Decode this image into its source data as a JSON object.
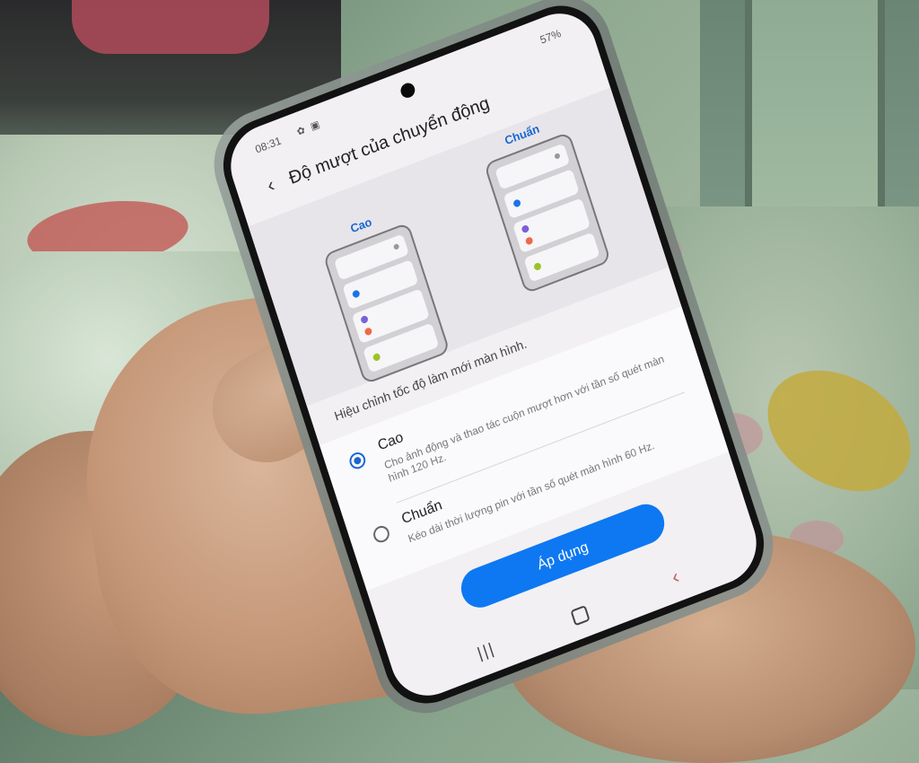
{
  "status_bar": {
    "time": "08:31",
    "icons": "✿ ▣",
    "battery": "57%"
  },
  "header": {
    "back_icon": "‹",
    "title": "Độ mượt của chuyển động"
  },
  "preview": {
    "high_label": "Cao",
    "standard_label": "Chuẩn"
  },
  "description": "Hiệu chỉnh tốc độ làm mới màn hình.",
  "options": [
    {
      "title": "Cao",
      "desc": "Cho ảnh động và thao tác cuộn mượt hơn với tần số quét màn hình 120 Hz.",
      "selected": true
    },
    {
      "title": "Chuẩn",
      "desc": "Kéo dài thời lượng pin với tần số quét màn hình 60 Hz.",
      "selected": false
    }
  ],
  "apply_label": "Áp dụng",
  "nav": {
    "recent_icon": "|||",
    "back_icon": "‹"
  },
  "colors": {
    "accent": "#1967d2",
    "button": "#0d78f2",
    "dot_blue": "#1a73e8",
    "dot_purple": "#7b61d9",
    "dot_orange": "#f06848",
    "dot_green": "#9bc424"
  }
}
